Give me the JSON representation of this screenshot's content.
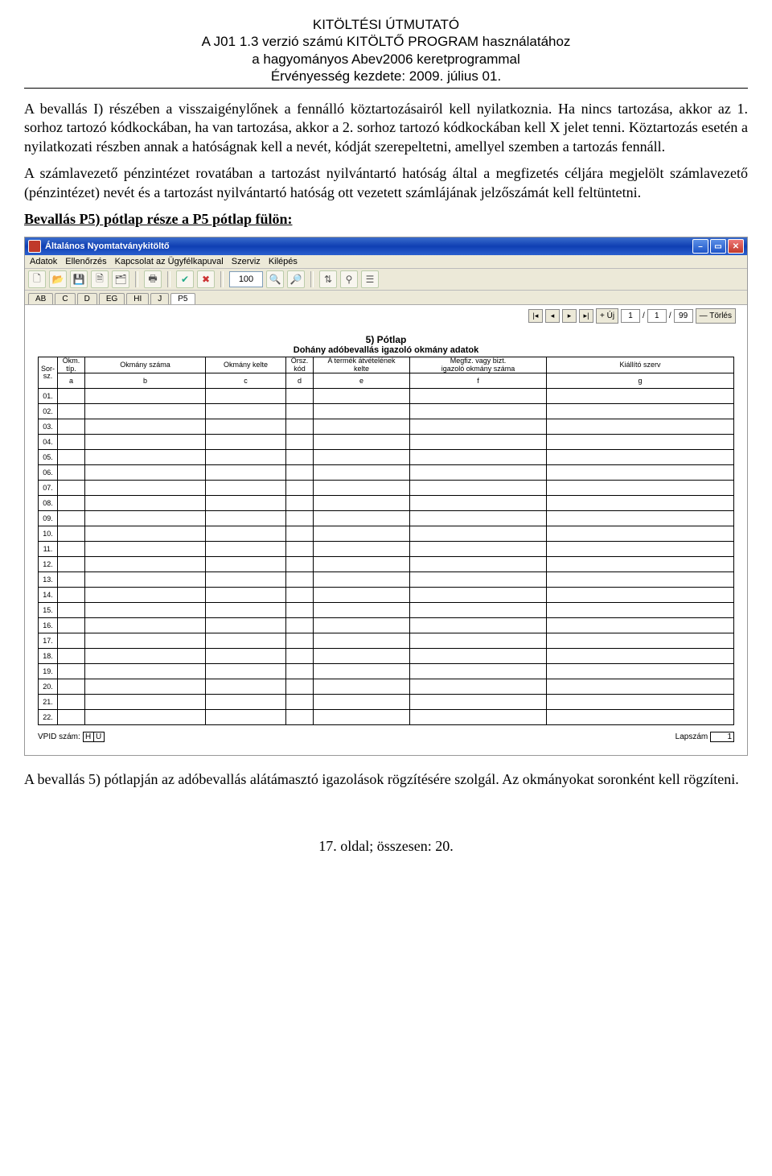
{
  "header": {
    "l1": "KITÖLTÉSI ÚTMUTATÓ",
    "l2": "A J01 1.3 verzió számú KITÖLTŐ PROGRAM használatához",
    "l3": "a hagyományos Abev2006 keretprogrammal",
    "l4": "Érvényesség kezdete: 2009. július 01."
  },
  "para1": "A bevallás I) részében a visszaigénylőnek a fennálló köztartozásairól kell nyilatkoznia. Ha nincs tartozása, akkor az 1. sorhoz tartozó kódkockában, ha van tartozása, akkor a 2. sorhoz tartozó kódkockában kell X jelet tenni. Köztartozás esetén a nyilatkozati részben annak a hatóságnak kell a nevét, kódját szerepeltetni, amellyel szemben a tartozás fennáll.",
  "para2": "A számlavezető pénzintézet rovatában a tartozást nyilvántartó hatóság által a megfizetés céljára megjelölt számlavezető (pénzintézet) nevét és a tartozást nyilvántartó hatóság ott vezetett számlájának jelzőszámát kell feltüntetni.",
  "sectionTitle": "Bevallás P5) pótlap része a P5 pótlap fülön:",
  "app": {
    "title": "Általános Nyomtatványkitöltő",
    "menu": [
      "Adatok",
      "Ellenőrzés",
      "Kapcsolat az Ügyfélkapuval",
      "Szerviz",
      "Kilépés"
    ],
    "zoom": "100",
    "tabs": [
      "AB",
      "C",
      "D",
      "EG",
      "HI",
      "J",
      "P5"
    ],
    "activeTab": "P5",
    "pager": {
      "cur": "1",
      "sep": "/",
      "b": "1",
      "c": "/",
      "tot": "99",
      "add": "+ Új",
      "del": "— Törlés"
    },
    "formTitle": "5) Pótlap",
    "formSub": "Dohány adóbevallás igazoló okmány adatok",
    "cols": {
      "sor1": "Sor-",
      "sor2": "sz.",
      "a1": "Okm.",
      "a2": "típ.",
      "a3": "a",
      "b1": "Okmány száma",
      "b3": "b",
      "c1": "Okmány kelte",
      "c3": "c",
      "d1": "Orsz.",
      "d2": "kód",
      "d3": "d",
      "e1": "A termék átvételének",
      "e2": "kelte",
      "e3": "e",
      "f1": "Megfiz. vagy bizt.",
      "f2": "igazoló okmány száma",
      "f3": "f",
      "g1": "Kiállító szerv",
      "g3": "g"
    },
    "rows": [
      "01.",
      "02.",
      "03.",
      "04.",
      "05.",
      "06.",
      "07.",
      "08.",
      "09.",
      "10.",
      "11.",
      "12.",
      "13.",
      "14.",
      "15.",
      "16.",
      "17.",
      "18.",
      "19.",
      "20.",
      "21.",
      "22."
    ],
    "vpidLabel": "VPID szám:",
    "vpid": [
      "H",
      "U"
    ],
    "lapLabel": "Lapszám",
    "lapVal": "1"
  },
  "afterPara": "A bevallás 5) pótlapján az adóbevallás alátámasztó igazolások rögzítésére szolgál. Az okmányokat soronként kell rögzíteni.",
  "pageNum": "17. oldal; összesen: 20."
}
